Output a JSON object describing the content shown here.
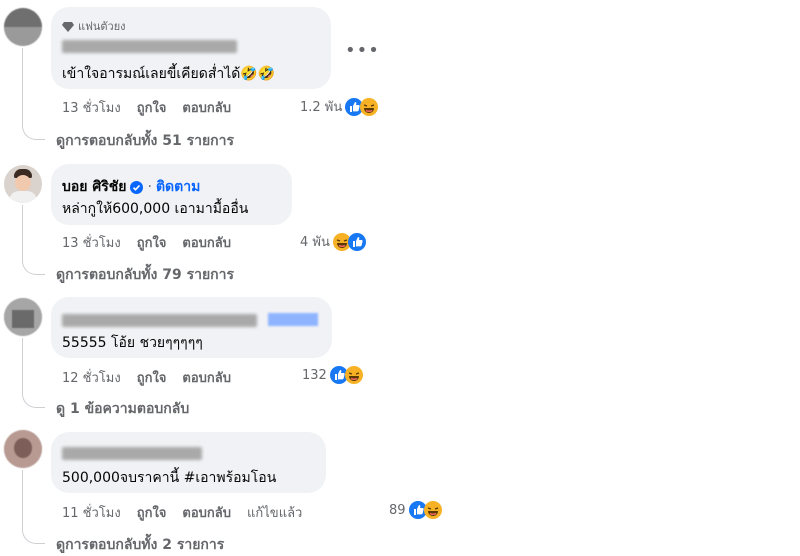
{
  "comments": [
    {
      "badge": "แฟนตัวยง",
      "text": "เข้าใจอารมณ์เลยขี้เคียดส่ำได้🤣🤣",
      "time": "13 ชั่วโมง",
      "like": "ถูกใจ",
      "reply": "ตอบกลับ",
      "reaction_count": "1.2 พัน",
      "replies_text": "ดูการตอบกลับทั้ง 51 รายการ",
      "more_icon": "more-horizontal-icon"
    },
    {
      "name": "บอย ศิริชัย",
      "follow": "ติดตาม",
      "dot": "·",
      "text": "หล่ากูให้600,000 เอามามื้ออื่น",
      "time": "13 ชั่วโมง",
      "like": "ถูกใจ",
      "reply": "ตอบกลับ",
      "reaction_count": "4 พัน",
      "replies_text": "ดูการตอบกลับทั้ง 79 รายการ"
    },
    {
      "text": "55555 โอ้ย ชวยๆๆๆๆๆ",
      "time": "12 ชั่วโมง",
      "like": "ถูกใจ",
      "reply": "ตอบกลับ",
      "reaction_count": "132",
      "replies_text": "ดู 1 ข้อความตอบกลับ"
    },
    {
      "text": "500,000จบราคานี้ #เอาพร้อมโอน",
      "time": "11 ชั่วโมง",
      "like": "ถูกใจ",
      "reply": "ตอบกลับ",
      "edited": "แก้ไขแล้ว",
      "reaction_count": "89",
      "replies_text": "ดูการตอบกลับทั้ง 2 รายการ"
    }
  ],
  "colors": {
    "bubble": "#f0f2f5",
    "meta": "#65676b",
    "accent": "#0866ff",
    "haha": "#f7b125",
    "like": "#1877f2"
  }
}
